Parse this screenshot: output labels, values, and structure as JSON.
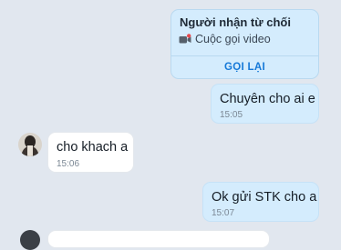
{
  "call_card": {
    "title": "Người nhận từ chối",
    "call_type": "Cuộc gọi video",
    "callback_label": "GỌI LẠI"
  },
  "messages": [
    {
      "direction": "out",
      "text": "Chuyên cho ai e",
      "time": "15:05"
    },
    {
      "direction": "in",
      "text": "cho khach a",
      "time": "15:06"
    },
    {
      "direction": "out",
      "text": "Ok gửi STK cho a",
      "time": "15:07"
    }
  ],
  "icons": {
    "call_type_icon": "video-camera-missed-icon",
    "avatar": "contact-avatar"
  },
  "colors": {
    "background": "#e1e7ef",
    "outgoing_bubble": "#d4ecfd",
    "incoming_bubble": "#ffffff",
    "accent": "#1679d8",
    "missed": "#e5484d"
  }
}
